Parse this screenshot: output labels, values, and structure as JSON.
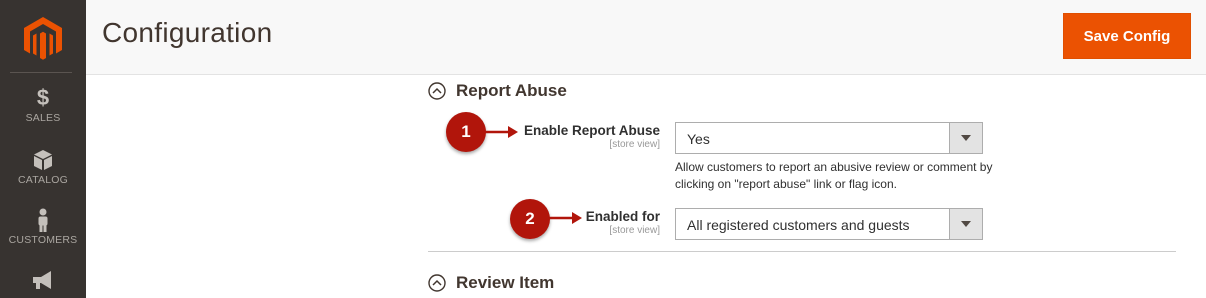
{
  "sidebar": {
    "logo": "magento-logo",
    "items": [
      {
        "icon": "dollar-icon",
        "label": "SALES"
      },
      {
        "icon": "box-icon",
        "label": "CATALOG"
      },
      {
        "icon": "person-icon",
        "label": "CUSTOMERS"
      },
      {
        "icon": "megaphone-icon",
        "label": ""
      }
    ]
  },
  "header": {
    "title": "Configuration",
    "save_label": "Save Config"
  },
  "sections": [
    {
      "title": "Report Abuse",
      "fields": [
        {
          "label": "Enable Report Abuse",
          "scope": "[store view]",
          "value": "Yes",
          "note": "Allow customers to report an abusive review or comment by clicking on \"report abuse\" link or flag icon."
        },
        {
          "label": "Enabled for",
          "scope": "[store view]",
          "value": "All registered customers and guests"
        }
      ]
    },
    {
      "title": "Review Item"
    }
  ],
  "annotations": [
    "1",
    "2"
  ],
  "colors": {
    "sidebar_bg": "#373330",
    "accent": "#eb5202",
    "annotation": "#b1150b"
  }
}
